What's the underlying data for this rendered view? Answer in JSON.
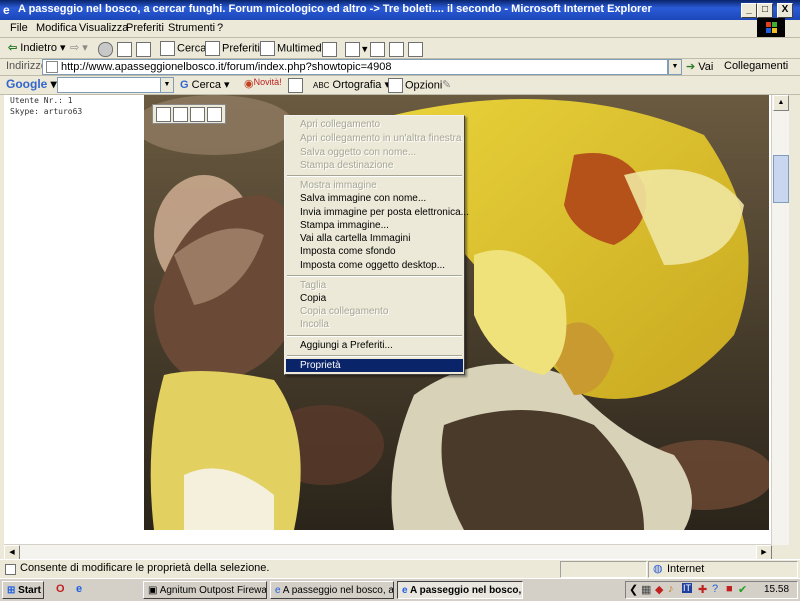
{
  "window": {
    "title": "A passeggio nel bosco, a cercar funghi. Forum micologico ed altro -> Tre boleti.... il secondo - Microsoft Internet Explorer",
    "min": "_",
    "max": "□",
    "close": "X"
  },
  "menu": [
    "File",
    "Modifica",
    "Visualizza",
    "Preferiti",
    "Strumenti",
    "?"
  ],
  "toolbar": {
    "back": "Indietro",
    "search": "Cerca",
    "favorites": "Preferiti",
    "multimedia": "Multimedia"
  },
  "address": {
    "label": "Indirizzo",
    "url": "http://www.apasseggionelbosco.it/forum/index.php?showtopic=4908",
    "go": "Vai",
    "links": "Collegamenti"
  },
  "google_bar": {
    "logo": "Google",
    "search": "Cerca",
    "news": "Novità!",
    "spell": "Ortografia",
    "options": "Opzioni"
  },
  "page": {
    "user_no": "Utente Nr.: 1",
    "skype": "Skype: arturo63"
  },
  "context_menu": [
    {
      "label": "Apri collegamento",
      "disabled": true
    },
    {
      "label": "Apri collegamento in un'altra finestra",
      "disabled": true
    },
    {
      "label": "Salva oggetto con nome...",
      "disabled": true
    },
    {
      "label": "Stampa destinazione",
      "disabled": true
    },
    {
      "label": "Mostra immagine",
      "disabled": true
    },
    {
      "label": "Salva immagine con nome...",
      "disabled": false
    },
    {
      "label": "Invia immagine per posta elettronica...",
      "disabled": false
    },
    {
      "label": "Stampa immagine...",
      "disabled": false
    },
    {
      "label": "Vai alla cartella Immagini",
      "disabled": false
    },
    {
      "label": "Imposta come sfondo",
      "disabled": false
    },
    {
      "label": "Imposta come oggetto desktop...",
      "disabled": false
    },
    {
      "label": "Taglia",
      "disabled": true
    },
    {
      "label": "Copia",
      "disabled": false
    },
    {
      "label": "Copia collegamento",
      "disabled": true
    },
    {
      "label": "Incolla",
      "disabled": true
    },
    {
      "label": "Aggiungi a Preferiti...",
      "disabled": false
    },
    {
      "label": "Proprietà",
      "disabled": false,
      "selected": true
    }
  ],
  "status": {
    "text": "Consente di modificare le proprietà della selezione.",
    "zone": "Internet"
  },
  "taskbar": {
    "start": "Start",
    "tasks": [
      "Agnitum Outpost Firewall ...",
      "A passeggio nel bosco, a ...",
      "A passeggio nel bosco,..."
    ],
    "clock": "15.58",
    "tray_badge": "IT"
  },
  "colors": {
    "title_blue": "#0a246a",
    "selection": "#0a246a",
    "disabled_text": "#a7a594"
  }
}
